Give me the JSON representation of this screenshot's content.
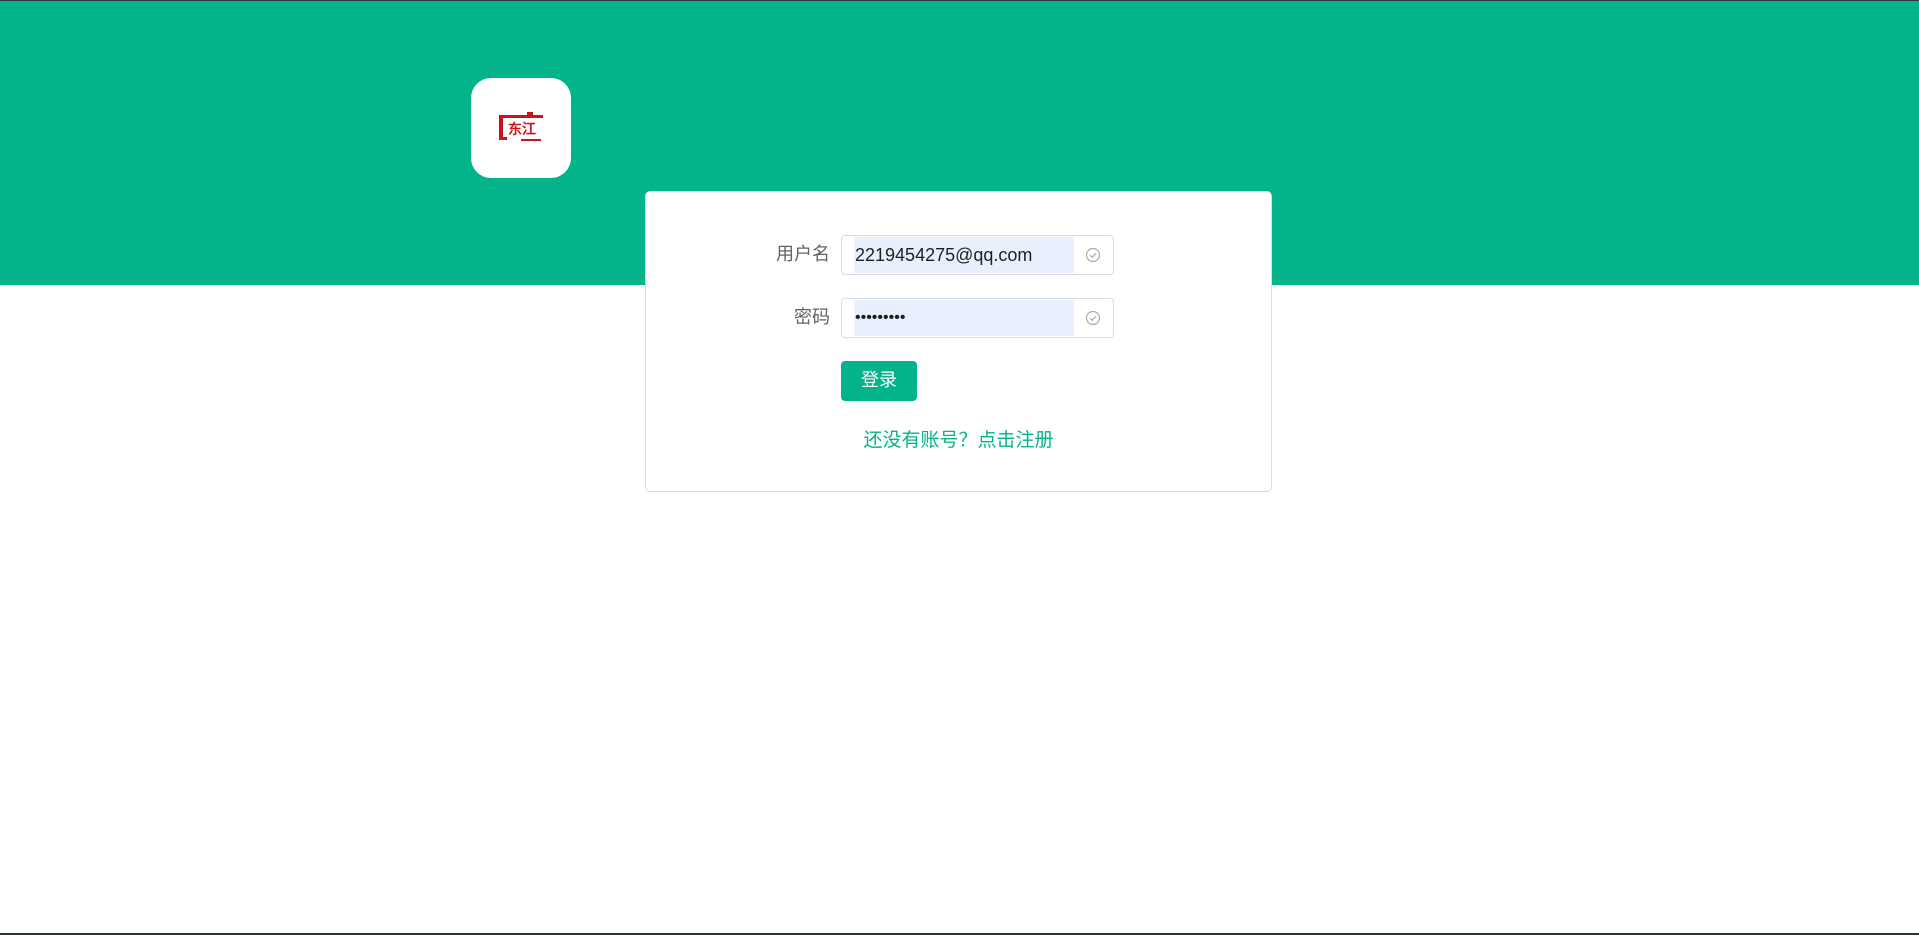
{
  "colors": {
    "brand": "#03b48b",
    "input_autofill_bg": "#e8f0fe",
    "label_text": "#606266",
    "logo_red": "#c8141e"
  },
  "logo": {
    "text": "东江",
    "icon": "dongjiang-logo-icon"
  },
  "form": {
    "username": {
      "label": "用户名",
      "value": "2219454275@qq.com",
      "status_icon": "circle-check-icon"
    },
    "password": {
      "label": "密码",
      "value": "•••••••••",
      "status_icon": "circle-check-icon"
    },
    "login_button_label": "登录",
    "register_link_text": "还没有账号？点击注册"
  }
}
